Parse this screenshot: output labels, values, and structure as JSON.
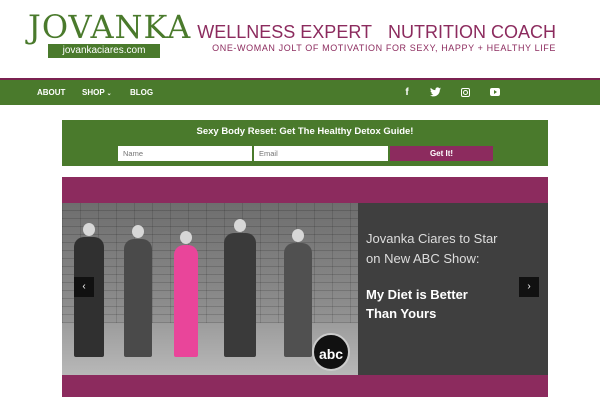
{
  "header": {
    "logo_word": "JOVANKA",
    "logo_url": "jovankaciares.com",
    "tagline_left": "WELLNESS EXPERT",
    "tagline_right": "NUTRITION COACH",
    "tagline_sub": "ONE-WOMAN JOLT OF MOTIVATION FOR SEXY, HAPPY + HEALTHY LIFE"
  },
  "nav": {
    "items": [
      {
        "label": "ABOUT"
      },
      {
        "label": "SHOP"
      },
      {
        "label": "BLOG"
      }
    ],
    "shop_chevron": "⌄",
    "social": [
      {
        "icon": "facebook-icon",
        "glyph": "f"
      },
      {
        "icon": "twitter-icon",
        "glyph": "t"
      },
      {
        "icon": "instagram-icon",
        "glyph": ""
      },
      {
        "icon": "youtube-icon",
        "glyph": ""
      }
    ]
  },
  "optin": {
    "title": "Sexy Body Reset: Get The Healthy Detox Guide!",
    "name_placeholder": "Name",
    "email_placeholder": "Email",
    "button_label": "Get It!"
  },
  "slider": {
    "heading": "Jovanka Ciares to Star on New ABC Show:",
    "bold_text": "My Diet is Better Than Yours",
    "badge": "abc",
    "prev_arrow": "‹",
    "next_arrow": "›"
  },
  "colors": {
    "brand_green": "#4a7a2c",
    "brand_plum": "#8c2b5e",
    "slide_panel": "#3f3f3f"
  }
}
